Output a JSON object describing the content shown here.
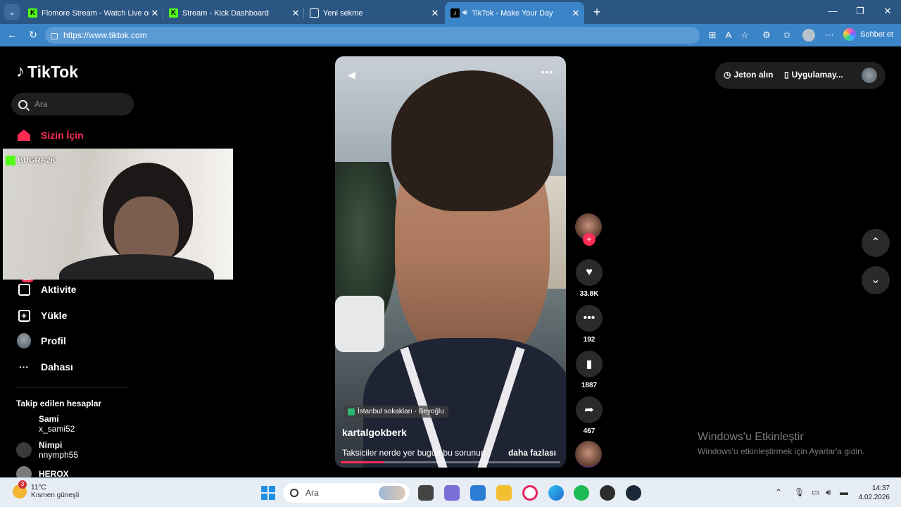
{
  "browser": {
    "tabs": [
      {
        "title": "Flomore Stream - Watch Live on Ki",
        "favicon": "kick-icon",
        "active": false
      },
      {
        "title": "Stream - Kick Dashboard",
        "favicon": "kick-icon",
        "active": false
      },
      {
        "title": "Yeni sekme",
        "favicon": "newtab-icon",
        "active": false
      },
      {
        "title": "TikTok - Make Your Day",
        "favicon": "tiktok-icon",
        "active": true
      }
    ],
    "url": "https://www.tiktok.com",
    "copilot_label": "Sohbet et",
    "accent": "#3c84c8",
    "tab_strip_color": "#2b5582"
  },
  "sidebar": {
    "brand": "TikTok",
    "search_placeholder": "Ara",
    "nav": [
      {
        "label": "Sizin İçin",
        "icon": "home-icon",
        "selected": true
      },
      {
        "label": "Aktivite",
        "icon": "inbox-icon",
        "badge": "23"
      },
      {
        "label": "Yükle",
        "icon": "upload-icon"
      },
      {
        "label": "Profil",
        "icon": "profile-avatar"
      },
      {
        "label": "Dahası",
        "icon": "more-icon"
      }
    ],
    "following_title": "Takip edilen hesaplar",
    "following": [
      {
        "name": "Sami",
        "handle": "x_sami52"
      },
      {
        "name": "Nimpi",
        "handle": "nnymph55"
      },
      {
        "name": "HEROX",
        "handle": ""
      }
    ]
  },
  "webcam": {
    "tag": "BUGRA2K"
  },
  "video": {
    "location": "İstanbul sokakları · Beyoğlu",
    "author": "kartalgokberk",
    "caption": "Taksiciler nerde yer bugün bu sorunun",
    "more_label": "daha fazlası",
    "progress": 0.2
  },
  "actions": {
    "likes": "33.8K",
    "comments": "192",
    "saves": "1887",
    "shares": "467"
  },
  "header_right": {
    "coins_label": "Jeton alın",
    "app_label": "Uygulamay..."
  },
  "watermark": {
    "title": "Windows'u Etkinleştir",
    "subtitle": "Windows'u etkinleştirmek için Ayarlar'a gidin."
  },
  "taskbar": {
    "weather_temp": "11°C",
    "weather_desc": "Kısmen güneşli",
    "weather_badge": "3",
    "search_placeholder": "Ara",
    "time": "14:37",
    "date": "4.02.2026"
  }
}
